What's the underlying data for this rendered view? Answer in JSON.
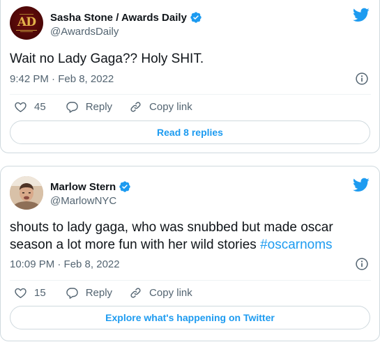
{
  "tweets": [
    {
      "display_name": "Sasha Stone / Awards Daily",
      "handle": "@AwardsDaily",
      "avatar_text": "AD",
      "text": "Wait no Lady Gaga?? Holy SHIT.",
      "text_parts": [],
      "timestamp": "9:42 PM · Feb 8, 2022",
      "likes": "45",
      "reply_label": "Reply",
      "copy_link_label": "Copy link",
      "cta_label": "Read 8 replies"
    },
    {
      "display_name": "Marlow Stern",
      "handle": "@MarlowNYC",
      "text_line1": "shouts to lady gaga, who was snubbed but made oscar",
      "text_line2_plain": "season a lot more fun with her wild stories ",
      "hashtag": "#oscarnoms",
      "timestamp": "10:09 PM · Feb 8, 2022",
      "likes": "15",
      "reply_label": "Reply",
      "copy_link_label": "Copy link",
      "cta_label": "Explore what's happening on Twitter"
    }
  ],
  "icons": {
    "verified": "verified-badge-icon",
    "bird": "twitter-bird-icon",
    "info": "info-icon",
    "heart": "heart-icon",
    "reply": "reply-icon",
    "link": "link-icon"
  },
  "colors": {
    "accent": "#1d9bf0",
    "text": "#0f1419",
    "secondary": "#536471",
    "border": "#cfd9de"
  }
}
